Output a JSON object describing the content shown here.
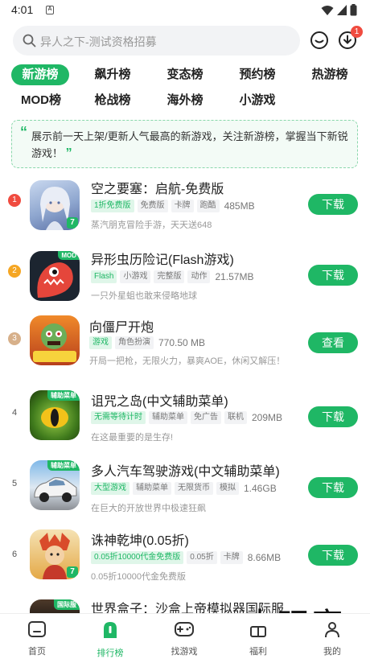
{
  "status": {
    "time": "4:01",
    "notif_icon": "A"
  },
  "search": {
    "placeholder": "异人之下-测试资格招募",
    "download_badge": "1"
  },
  "tabs": [
    {
      "label": "新游榜",
      "active": true
    },
    {
      "label": "飙升榜"
    },
    {
      "label": "变态榜"
    },
    {
      "label": "预约榜"
    },
    {
      "label": "热游榜"
    },
    {
      "label": "MOD榜"
    },
    {
      "label": "枪战榜"
    },
    {
      "label": "海外榜"
    },
    {
      "label": "小游戏"
    }
  ],
  "notice": {
    "text": "展示前一天上架/更新人气最高的新游戏，关注新游榜，掌握当下新锐游戏！"
  },
  "games": [
    {
      "rank": "1",
      "title": "空之要塞：启航-免费版",
      "tags": [
        "1折免费版",
        "免费版",
        "卡牌",
        "跑酷"
      ],
      "size": "485MB",
      "desc": "蒸汽朋克冒险手游，天天送648",
      "button": "下载",
      "icon_tag": ""
    },
    {
      "rank": "2",
      "title": "异形虫历险记(Flash游戏)",
      "tags": [
        "Flash",
        "小游戏",
        "完整版",
        "动作"
      ],
      "size": "21.57MB",
      "desc": "一只外星蛆也敢来侵略地球",
      "button": "下载",
      "icon_tag": "MOD"
    },
    {
      "rank": "3",
      "title": "向僵尸开炮",
      "tags": [
        "游戏",
        "角色扮演"
      ],
      "size": "770.50 MB",
      "desc": "开局一把枪，无限火力，暴爽AOE，休闲又解压！",
      "button": "查看",
      "icon_tag": ""
    },
    {
      "rank": "4",
      "title": "诅咒之岛(中文辅助菜单)",
      "tags": [
        "无需等待计时",
        "辅助菜单",
        "免广告",
        "联机"
      ],
      "size": "209MB",
      "desc": "在这最重要的是生存!",
      "button": "下载",
      "icon_tag": "辅助菜单"
    },
    {
      "rank": "5",
      "title": "多人汽车驾驶游戏(中文辅助菜单)",
      "tags": [
        "大型游戏",
        "辅助菜单",
        "无限货币",
        "模拟"
      ],
      "size": "1.46GB",
      "desc": "在巨大的开放世界中极速狂飙",
      "button": "下载",
      "icon_tag": "辅助菜单"
    },
    {
      "rank": "6",
      "title": "诛神乾坤(0.05折)",
      "tags": [
        "0.05折10000代金免费版",
        "0.05折",
        "卡牌"
      ],
      "size": "8.66MB",
      "desc": "0.05折10000代金免费版",
      "button": "下载",
      "icon_tag": ""
    },
    {
      "rank": "",
      "title": "世界盒子：沙盒上帝模拟器国际服",
      "tags": [],
      "size": "",
      "desc": "",
      "button": "",
      "icon_tag": "国际服"
    }
  ],
  "bottom_nav": [
    {
      "label": "首页",
      "icon": "home-icon"
    },
    {
      "label": "排行榜",
      "icon": "ranking-icon",
      "active": true
    },
    {
      "label": "找游戏",
      "icon": "gamepad-icon"
    },
    {
      "label": "福利",
      "icon": "gift-icon"
    },
    {
      "label": "我的",
      "icon": "profile-icon"
    }
  ],
  "watermark": "大玩家",
  "colors": {
    "accent": "#1fb765",
    "rank1": "#f04b3f",
    "rank2": "#f5a623",
    "rank3": "#d7b08a"
  }
}
